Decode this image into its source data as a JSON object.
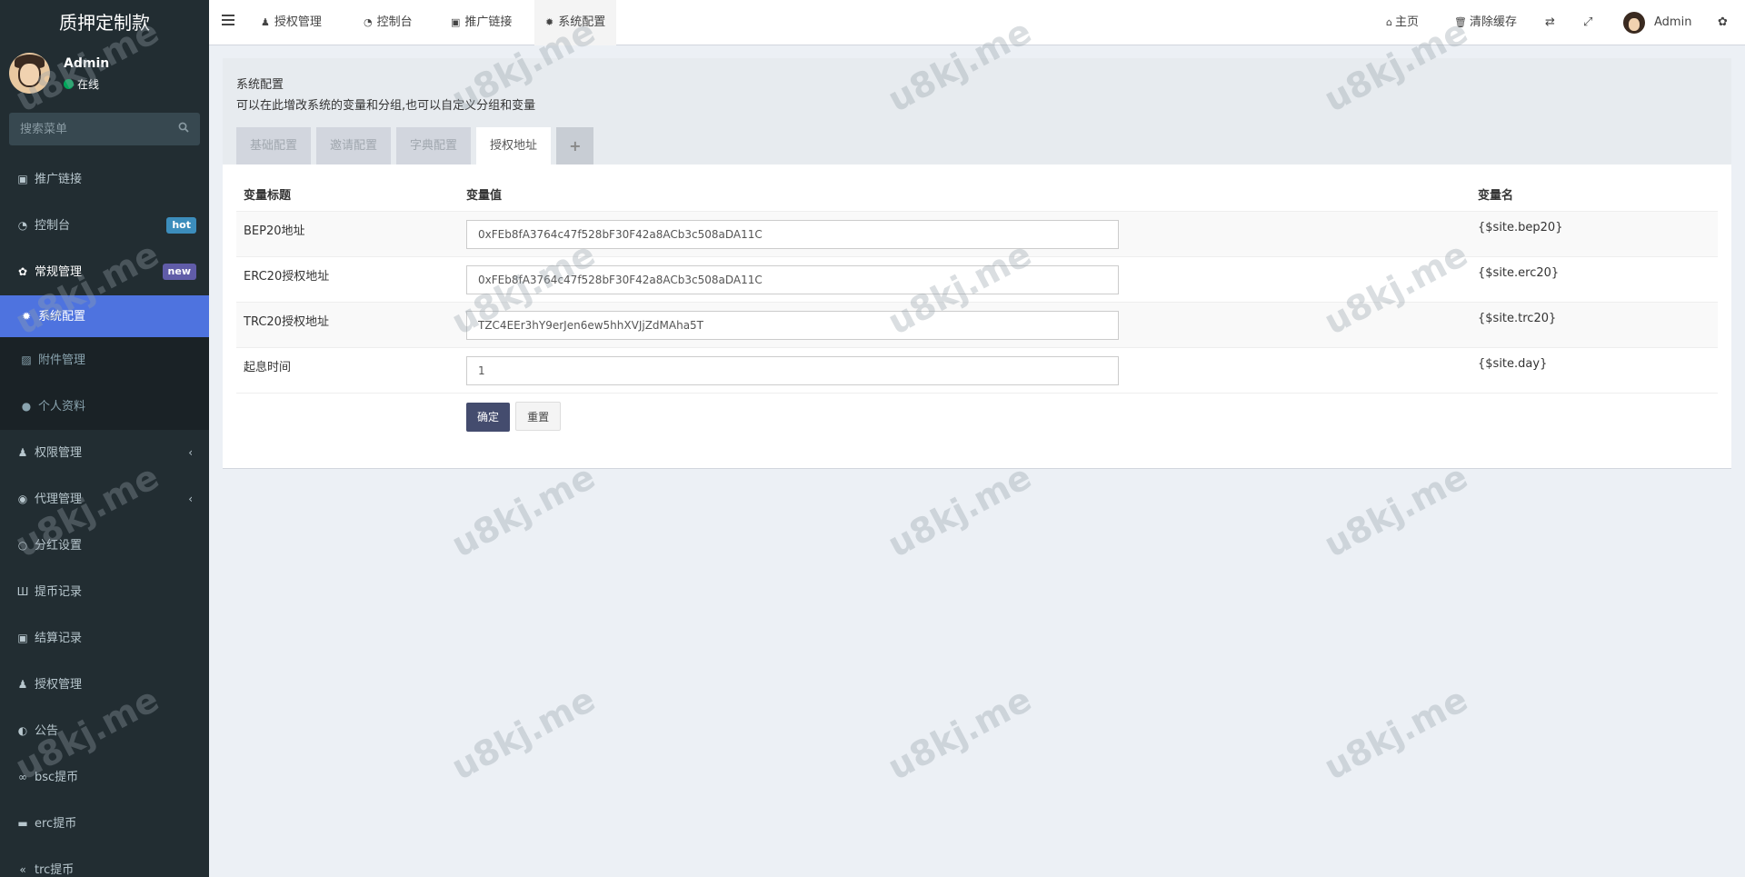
{
  "app": {
    "title": "质押定制款"
  },
  "user": {
    "name": "Admin",
    "status": "在线"
  },
  "search": {
    "placeholder": "搜索菜单"
  },
  "sidebar": {
    "items": [
      {
        "label": "推广链接",
        "icon": "link-icon"
      },
      {
        "label": "控制台",
        "icon": "dashboard-icon",
        "badge": "hot"
      },
      {
        "label": "常规管理",
        "icon": "cogs-icon",
        "badge": "new"
      },
      {
        "label": "系统配置",
        "icon": "gear-icon"
      },
      {
        "label": "附件管理",
        "icon": "image-icon"
      },
      {
        "label": "个人资料",
        "icon": "user-icon"
      },
      {
        "label": "权限管理",
        "icon": "users-icon"
      },
      {
        "label": "代理管理",
        "icon": "user-circle-icon"
      },
      {
        "label": "分红设置",
        "icon": "circle-icon"
      },
      {
        "label": "提币记录",
        "icon": "bank-icon"
      },
      {
        "label": "结算记录",
        "icon": "card-icon"
      },
      {
        "label": "授权管理",
        "icon": "users-icon"
      },
      {
        "label": "公告",
        "icon": "adjust-icon"
      },
      {
        "label": "bsc提币",
        "icon": "bicycle-icon"
      },
      {
        "label": "erc提币",
        "icon": "briefcase-icon"
      },
      {
        "label": "trc提币",
        "icon": "rewind-icon"
      }
    ]
  },
  "topnav": {
    "tabs": [
      {
        "label": "授权管理"
      },
      {
        "label": "控制台"
      },
      {
        "label": "推广链接"
      },
      {
        "label": "系统配置"
      }
    ],
    "home": "主页",
    "clear_cache": "清除缓存",
    "user": "Admin"
  },
  "page": {
    "title": "系统配置",
    "description": "可以在此增改系统的变量和分组,也可以自定义分组和变量",
    "tabs": [
      {
        "label": "基础配置"
      },
      {
        "label": "邀请配置"
      },
      {
        "label": "字典配置"
      },
      {
        "label": "授权地址"
      },
      {
        "label": "+"
      }
    ]
  },
  "table": {
    "headers": [
      "变量标题",
      "变量值",
      "变量名"
    ],
    "rows": [
      {
        "title": "BEP20地址",
        "value": "0xFEb8fA3764c47f528bF30F42a8ACb3c508aDA11C",
        "name": "{$site.bep20}"
      },
      {
        "title": "ERC20授权地址",
        "value": "0xFEb8fA3764c47f528bF30F42a8ACb3c508aDA11C",
        "name": "{$site.erc20}"
      },
      {
        "title": "TRC20授权地址",
        "value": "TZC4EEr3hY9erJen6ew5hhXVJjZdMAha5T",
        "name": "{$site.trc20}"
      },
      {
        "title": "起息时间",
        "value": "1",
        "name": "{$site.day}"
      }
    ]
  },
  "buttons": {
    "submit": "确定",
    "reset": "重置"
  },
  "watermark": "u8kj.me"
}
